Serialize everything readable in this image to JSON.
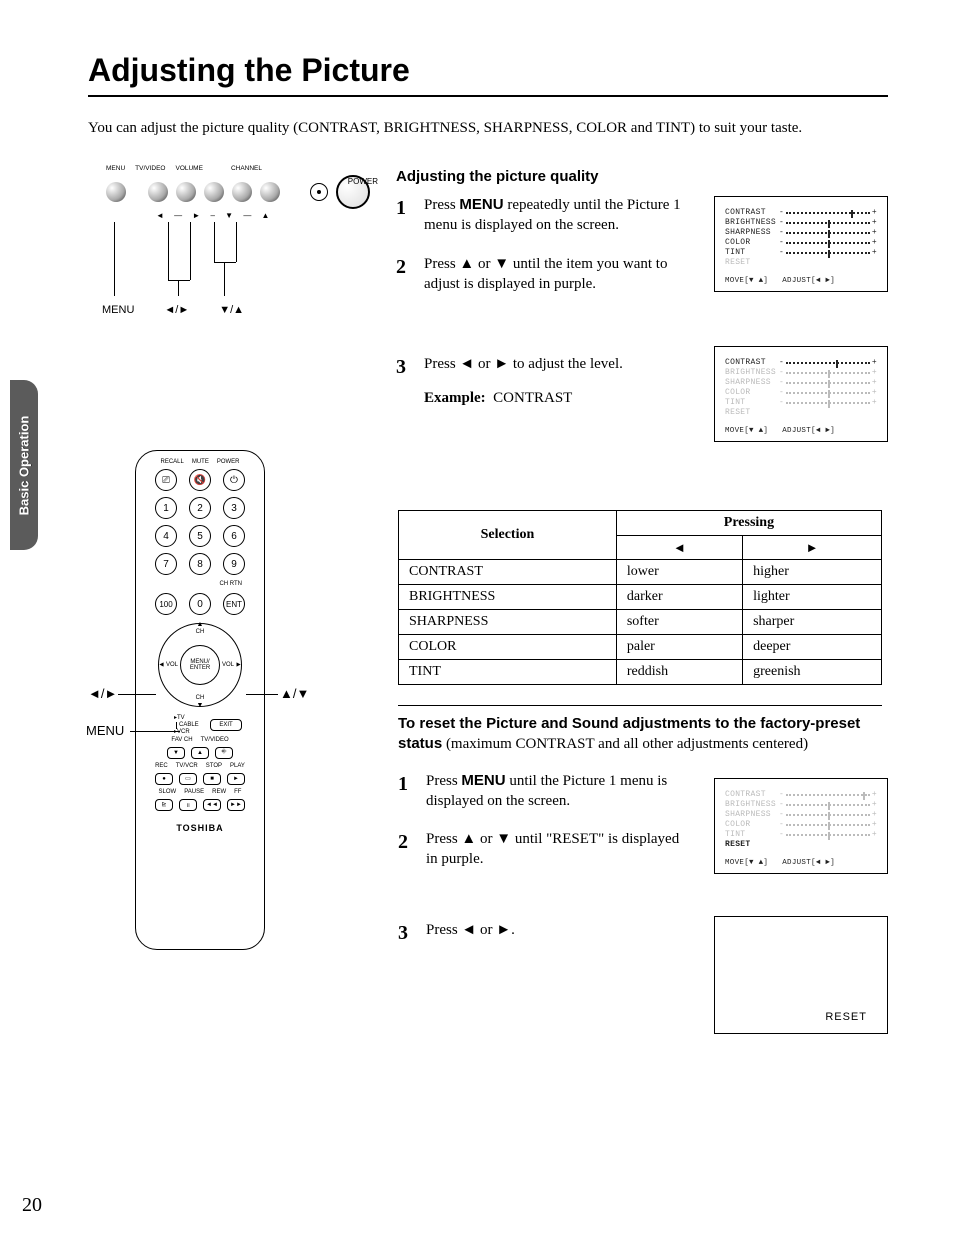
{
  "side_tab": "Basic Operation",
  "title": "Adjusting the Picture",
  "intro": "You can adjust the picture quality (CONTRAST, BRIGHTNESS, SHARPNESS, COLOR and TINT) to suit your taste.",
  "page_number": "20",
  "panel": {
    "labels": [
      "MENU",
      "TV/VIDEO",
      "VOLUME",
      "CHANNEL"
    ],
    "power_label": "POWER",
    "callout_menu": "MENU",
    "callout_arrows_lr": "◄/►",
    "callout_arrows_ud": "▼/▲"
  },
  "section1": {
    "heading": "Adjusting the picture quality",
    "step1_a": "Press ",
    "step1_menu": "MENU",
    "step1_b": " repeatedly until the Picture 1 menu is displayed on the screen.",
    "step2_a": "Press ",
    "step2_b": " or ",
    "step2_c": " until the item you want to adjust is displayed in purple.",
    "step3_a": "Press ",
    "step3_b": " or ",
    "step3_c": " to adjust the level.",
    "example_label": "Example:",
    "example_value": "CONTRAST"
  },
  "osd": {
    "items": [
      "CONTRAST",
      "BRIGHTNESS",
      "SHARPNESS",
      "COLOR",
      "TINT",
      "RESET"
    ],
    "foot_move": "MOVE[▼ ▲]",
    "foot_adjust": "ADJUST[◄ ►]",
    "reset_big": "RESET",
    "marker_positions": {
      "all_centered": 50,
      "contrast_high": 78
    }
  },
  "table": {
    "header_selection": "Selection",
    "header_pressing": "Pressing",
    "arrow_left": "◄",
    "arrow_right": "►",
    "rows": [
      {
        "sel": "CONTRAST",
        "l": "lower",
        "r": "higher"
      },
      {
        "sel": "BRIGHTNESS",
        "l": "darker",
        "r": "lighter"
      },
      {
        "sel": "SHARPNESS",
        "l": "softer",
        "r": "sharper"
      },
      {
        "sel": "COLOR",
        "l": "paler",
        "r": "deeper"
      },
      {
        "sel": "TINT",
        "l": "reddish",
        "r": "greenish"
      }
    ]
  },
  "reset": {
    "heading": "To reset the Picture and Sound adjustments to the factory-preset status",
    "sub": "(maximum CONTRAST and all other adjustments centered)",
    "step1_a": "Press ",
    "step1_menu": "MENU",
    "step1_b": " until the Picture 1 menu is displayed on the screen.",
    "step2_a": "Press ",
    "step2_b": " or ",
    "step2_c": " until \"RESET\" is displayed in purple.",
    "step3_a": "Press ",
    "step3_b": " or ",
    "step3_c": "."
  },
  "remote": {
    "top_labels": [
      "RECALL",
      "MUTE",
      "POWER"
    ],
    "top_icons": [
      "⎚",
      "🔇",
      "⏻"
    ],
    "digits": [
      "1",
      "2",
      "3",
      "4",
      "5",
      "6",
      "7",
      "8",
      "9",
      "100",
      "0",
      "ENT"
    ],
    "ch_rtn": "CH RTN",
    "dpad_center": "MENU/\nENTER",
    "dpad_up": "CH",
    "dpad_down": "CH",
    "dpad_left": "VOL",
    "dpad_right": "VOL",
    "mode_labels": [
      "TV",
      "CABLE",
      "VCR"
    ],
    "exit": "EXIT",
    "favch": "FAV CH",
    "tvvideo": "TV/VIDEO",
    "rec_row_labels": [
      "REC",
      "TV/VCR",
      "STOP",
      "PLAY"
    ],
    "rec_row_icons": [
      "●",
      "▭",
      "■",
      "►"
    ],
    "slow_row_labels": [
      "SLOW",
      "PAUSE",
      "REW",
      "FF"
    ],
    "slow_row_icons": [
      "⊵",
      "॥",
      "◄◄",
      "►►"
    ],
    "brand": "TOSHIBA",
    "callout_lr": "◄/►",
    "callout_menu": "MENU",
    "callout_ud": "▲/▼"
  }
}
